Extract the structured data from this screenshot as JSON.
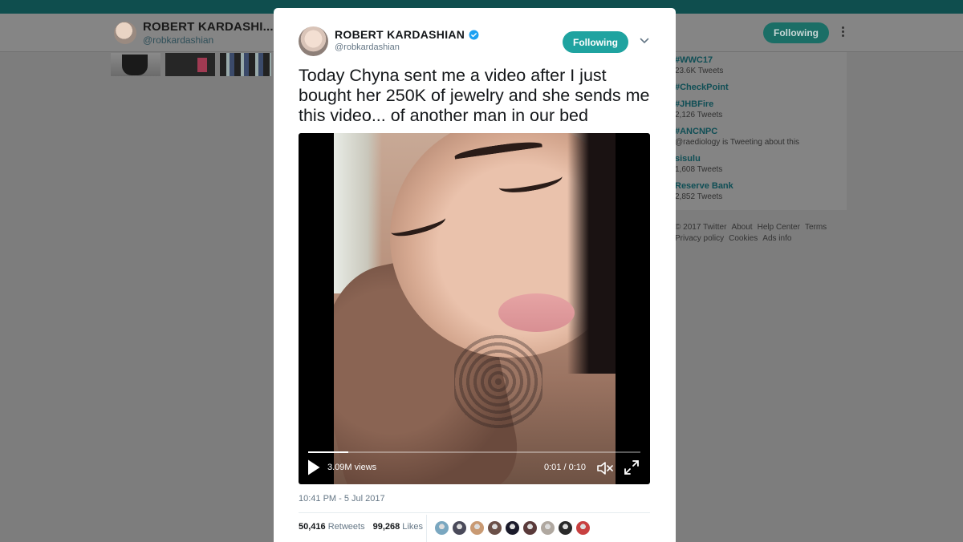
{
  "background": {
    "profile_name": "ROBERT KARDASHI...",
    "profile_handle": "@robkardashian",
    "follow_label": "Following",
    "trends": [
      {
        "name": "#WWC17",
        "meta": "23.6K Tweets"
      },
      {
        "name": "#CheckPoint",
        "meta": ""
      },
      {
        "name": "#JHBFire",
        "meta": "2,126 Tweets"
      },
      {
        "name": "#ANCNPC",
        "meta": "@raediology is Tweeting about this"
      },
      {
        "name": "sisulu",
        "meta": "1,608 Tweets"
      },
      {
        "name": "Reserve Bank",
        "meta": "2,852 Tweets"
      }
    ],
    "footer": [
      "© 2017 Twitter",
      "About",
      "Help Center",
      "Terms",
      "Privacy policy",
      "Cookies",
      "Ads info"
    ]
  },
  "tweet": {
    "author_name": "ROBERT KARDASHIAN",
    "author_handle": "@robkardashian",
    "follow_label": "Following",
    "text": "Today Chyna sent me a video after I just bought her 250K of jewelry and she sends me this video... of another man in our bed",
    "video": {
      "views": "3.09M views",
      "time": "0:01 / 0:10",
      "progress": 0.12
    },
    "timestamp": "10:41 PM - 5 Jul 2017",
    "retweets_count": "50,416",
    "retweets_label": "Retweets",
    "likes_count": "99,268",
    "likes_label": "Likes"
  },
  "colors": {
    "accent": "#1fa3a0",
    "verified": "#1da1f2",
    "topbar": "#0f4e4e"
  },
  "likers": [
    "#7aa7c0",
    "#4a4a5a",
    "#c99a73",
    "#6b5048",
    "#1a1a2a",
    "#5a3a3a",
    "#b0a8a0",
    "#2a2a2a",
    "#c84040"
  ]
}
